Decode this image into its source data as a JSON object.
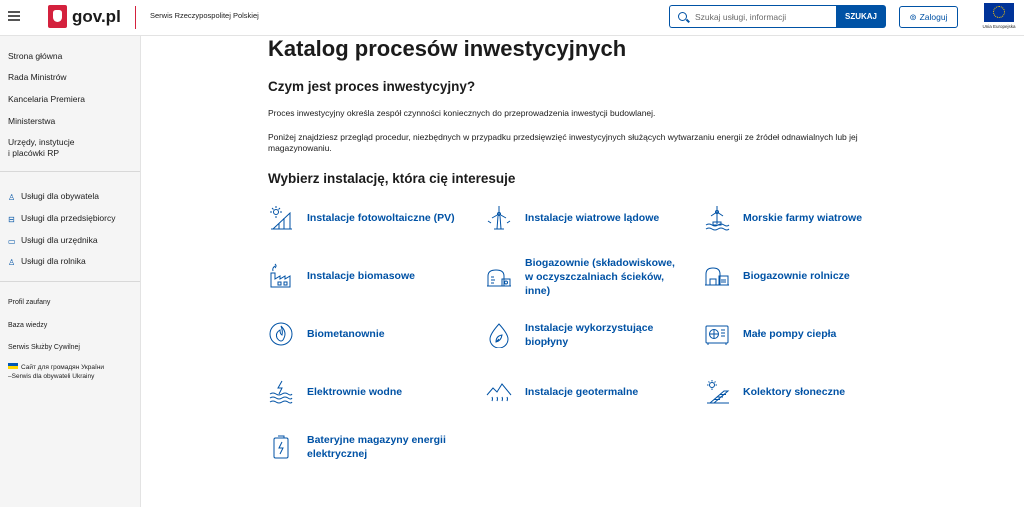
{
  "header": {
    "logo_text": "gov.pl",
    "service_name": "Serwis Rzeczypospolitej Polskiej",
    "search_placeholder": "Szukaj usługi, informacji",
    "search_button": "SZUKAJ",
    "login_button": "Zaloguj",
    "eu_label": "Unia Europejska"
  },
  "sidebar": {
    "main_items": [
      "Strona główna",
      "Rada Ministrów",
      "Kancelaria Premiera",
      "Ministerstwa",
      "Urzędy, instytucje",
      "i placówki RP"
    ],
    "service_items": [
      "Usługi dla obywatela",
      "Usługi dla przedsiębiorcy",
      "Usługi dla urzędnika",
      "Usługi dla rolnika"
    ],
    "extra_items": [
      "Profil zaufany",
      "Baza wiedzy",
      "Serwis Służby Cywilnej"
    ],
    "ukraine_line1": "Сайт для громадян України",
    "ukraine_line2": "–Serwis dla obywateli Ukrainy"
  },
  "main": {
    "title": "Katalog procesów inwestycyjnych",
    "subtitle": "Czym jest proces inwestycyjny?",
    "paragraph1": "Proces inwestycyjny określa zespół czynności koniecznych do przeprowadzenia inwestycji budowlanej.",
    "paragraph2_line1": "Poniżej znajdziesz przegląd procedur, niezbędnych w przypadku przedsięwzięć inwestycyjnych służących wytwarzaniu energii ze źródeł odnawialnych lub jej",
    "paragraph2_line2": "magazynowaniu.",
    "section_heading": "Wybierz instalację, która cię interesuje"
  },
  "tiles": [
    {
      "icon": "solar-panel-icon",
      "lines": [
        "Instalacje fotowoltaiczne (PV)"
      ]
    },
    {
      "icon": "wind-turbine-icon",
      "lines": [
        "Instalacje wiatrowe lądowe"
      ]
    },
    {
      "icon": "offshore-wind-icon",
      "lines": [
        "Morskie farmy wiatrowe"
      ]
    },
    {
      "icon": "biomass-factory-icon",
      "lines": [
        "Instalacje biomasowe"
      ]
    },
    {
      "icon": "biogas-tank-icon",
      "lines": [
        "Biogazownie (składowiskowe,",
        "w oczyszczalniach ścieków,",
        "inne)"
      ]
    },
    {
      "icon": "agri-biogas-icon",
      "lines": [
        "Biogazownie rolnicze"
      ]
    },
    {
      "icon": "biomethane-flame-icon",
      "lines": [
        "Biometanownie"
      ]
    },
    {
      "icon": "bioliquid-drop-icon",
      "lines": [
        "Instalacje wykorzystujące",
        "biopłyny"
      ]
    },
    {
      "icon": "heat-pump-icon",
      "lines": [
        "Małe pompy ciepła"
      ]
    },
    {
      "icon": "hydro-power-icon",
      "lines": [
        "Elektrownie wodne"
      ]
    },
    {
      "icon": "geothermal-icon",
      "lines": [
        "Instalacje geotermalne"
      ]
    },
    {
      "icon": "solar-collector-icon",
      "lines": [
        "Kolektory słoneczne"
      ]
    },
    {
      "icon": "battery-storage-icon",
      "lines": [
        "Bateryjne magazyny energii",
        "elektrycznej"
      ]
    }
  ],
  "colors": {
    "brand_blue": "#0052a5",
    "brand_red": "#d4213d",
    "sidebar_bg": "#f5f5f5"
  }
}
